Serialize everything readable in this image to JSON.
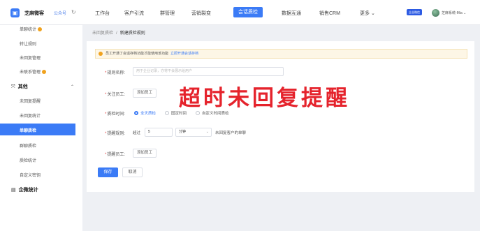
{
  "app": {
    "name": "芝麻微客",
    "channel": "公众号"
  },
  "nav": [
    "工作台",
    "客户引流",
    "群管理",
    "营销裂变",
    "会话质检",
    "数据互通",
    "销售CRM",
    "更多 ⌄"
  ],
  "nav_active_index": 4,
  "user": {
    "status_tag": "企业微信",
    "name": "芝麻系统-Mia ⌄"
  },
  "sidebar": {
    "items_top": [
      {
        "label": "单聊统计",
        "badge": true
      },
      {
        "label": "转让规则"
      },
      {
        "label": "未回复管理"
      },
      {
        "label": "未联系管理",
        "badge": true
      }
    ],
    "group_other": {
      "label": "其他",
      "caret": "⌃"
    },
    "items_other": [
      {
        "label": "未回复提醒"
      },
      {
        "label": "未回复统计"
      },
      {
        "label": "单聊质检",
        "active": true
      },
      {
        "label": "群聊质检"
      },
      {
        "label": "质检统计"
      },
      {
        "label": "自定义密钥"
      }
    ],
    "group_stats": {
      "label": "企微统计"
    }
  },
  "breadcrumb": {
    "parent": "未回复质检",
    "sep": "/",
    "current": "新建质检规则"
  },
  "notice": {
    "text": "员工开通了会话存档功能才能使用该功能",
    "link": "立即开通会话存档"
  },
  "form": {
    "rule_name": {
      "label": "规则名称:",
      "placeholder": "用于企业记录，亦将不会展示给用户"
    },
    "staff": {
      "label": "关注员工:",
      "button": "添加员工"
    },
    "time": {
      "label": "质检时间:",
      "options": [
        "全天质检",
        "固定时间",
        "自定义时间质检"
      ],
      "selected": 0
    },
    "remind_rule": {
      "label": "提醒规则:",
      "prefix": "超过",
      "value": "5",
      "unit": "分钟",
      "suffix": "未回复客户的单聊"
    },
    "remind_staff": {
      "label": "提醒员工:",
      "button": "添加员工"
    },
    "save": "保存",
    "cancel": "取消"
  },
  "overlay": "超时未回复提醒",
  "colors": {
    "primary": "#3b7bf6",
    "overlay": "#e5232c",
    "warning": "#f0a21e"
  }
}
